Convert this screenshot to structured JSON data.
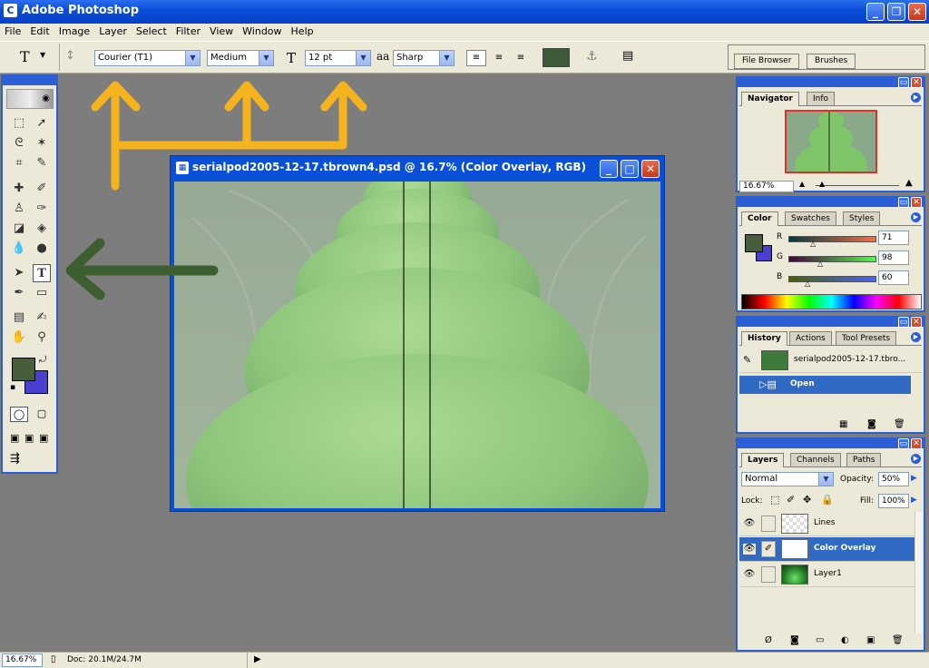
{
  "app": {
    "title": "Adobe Photoshop",
    "icon_letter": "C"
  },
  "window_controls": {
    "minimize": "_",
    "restore": "❐",
    "close": "✕"
  },
  "menu": [
    "File",
    "Edit",
    "Image",
    "Layer",
    "Select",
    "Filter",
    "View",
    "Window",
    "Help"
  ],
  "options": {
    "tool_glyph": "T",
    "font_family": "Courier (T1)",
    "font_style": "Medium",
    "font_size": "12 pt",
    "antialias_glyph": "aa",
    "antialias": "Sharp",
    "text_color": "#3f5a3a",
    "tabs": [
      "File Browser",
      "Brushes"
    ]
  },
  "document": {
    "title": "serialpod2005-12-17.tbrown4.psd @ 16.7% (Color Overlay, RGB)"
  },
  "navigator": {
    "tabs": [
      "Navigator",
      "Info"
    ],
    "zoom": "16.67%"
  },
  "color": {
    "tabs": [
      "Color",
      "Swatches",
      "Styles"
    ],
    "foreground": "#475e3c",
    "background": "#4a3fd0",
    "channels": [
      {
        "label": "R",
        "value": "71"
      },
      {
        "label": "G",
        "value": "98"
      },
      {
        "label": "B",
        "value": "60"
      }
    ]
  },
  "history": {
    "tabs": [
      "History",
      "Actions",
      "Tool Presets"
    ],
    "snapshot": "serialpod2005-12-17.tbro...",
    "step": "Open"
  },
  "layers": {
    "tabs": [
      "Layers",
      "Channels",
      "Paths"
    ],
    "blend_mode": "Normal",
    "opacity_label": "Opacity:",
    "opacity": "50%",
    "lock_label": "Lock:",
    "fill_label": "Fill:",
    "fill": "100%",
    "items": [
      {
        "name": "Lines"
      },
      {
        "name": "Color Overlay"
      },
      {
        "name": "Layer1"
      }
    ]
  },
  "status": {
    "zoom": "16.67%",
    "doc": "Doc: 20.1M/24.7M"
  },
  "annotations": {
    "arrow_up_color": "#f5b41e",
    "arrow_left_color": "#3d5e30"
  }
}
